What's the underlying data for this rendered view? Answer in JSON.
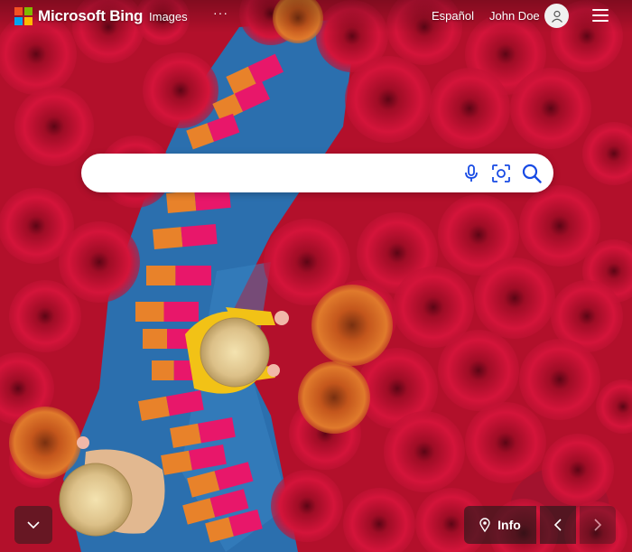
{
  "header": {
    "brand": "Microsoft Bing",
    "nav_images": "Images",
    "nav_more": "···",
    "language_link": "Español",
    "user_name": "John Doe",
    "logo_colors": [
      "#f25022",
      "#7fba00",
      "#00a4ef",
      "#ffb900"
    ]
  },
  "search": {
    "value": "",
    "placeholder": "",
    "icons": [
      "microphone-icon",
      "visual-search-icon",
      "search-icon"
    ],
    "accent_color": "#174ae4"
  },
  "footer": {
    "info_label": "Info",
    "icons": [
      "chevron-down-icon",
      "location-pin-icon",
      "chevron-left-icon",
      "chevron-right-icon"
    ]
  },
  "colors": {
    "incense_red": "#c8102e",
    "incense_magenta": "#e8176a",
    "cloth_blue": "#2a6fb0",
    "orange_bundles": "#e8822a"
  }
}
